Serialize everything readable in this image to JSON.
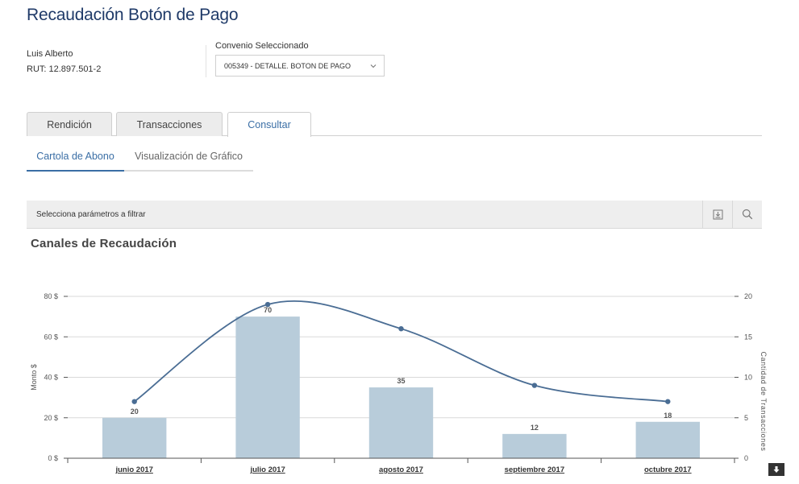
{
  "header": {
    "title": "Recaudación Botón de Pago"
  },
  "user": {
    "name": "Luis Alberto",
    "rut": "RUT: 12.897.501-2"
  },
  "convenio": {
    "label": "Convenio Seleccionado",
    "selected": "005349 - DETALLE. BOTON DE PAGO"
  },
  "tabs": [
    {
      "label": "Rendición",
      "active": false
    },
    {
      "label": "Transacciones",
      "active": false
    },
    {
      "label": "Consultar",
      "active": true
    }
  ],
  "subtabs": [
    {
      "label": "Cartola de Abono",
      "active": true
    },
    {
      "label": "Visualización de Gráfico",
      "active": false
    }
  ],
  "filter": {
    "text": "Selecciona parámetros a filtrar",
    "icons": [
      "download-icon",
      "search-icon"
    ]
  },
  "chart_title": "Canales de Recaudación",
  "chart_data": {
    "type": "bar",
    "categories": [
      "junio 2017",
      "julio 2017",
      "agosto 2017",
      "septiembre 2017",
      "octubre 2017"
    ],
    "series": [
      {
        "type": "bar",
        "axis": "left",
        "values": [
          20,
          70,
          35,
          12,
          18
        ],
        "color": "#b8ccda"
      },
      {
        "type": "line",
        "axis": "right",
        "values": [
          7,
          19,
          16,
          9,
          7
        ],
        "color": "#4a6d94"
      }
    ],
    "data_labels": [
      "20",
      "70",
      "35",
      "12",
      "18"
    ],
    "ylabel": "Monto $",
    "y2label": "Cantidad de Transacciones",
    "ylim": [
      0,
      80
    ],
    "y2lim": [
      0,
      20
    ],
    "yticks": [
      "0 $",
      "20 $",
      "40 $",
      "60 $",
      "80 $"
    ],
    "y2ticks": [
      "0",
      "5",
      "10",
      "15",
      "20"
    ],
    "grid": true,
    "colors": {
      "bar": "#b8ccda",
      "line": "#4a6d94",
      "grid": "#d9d9d9",
      "axis": "#555555"
    }
  }
}
